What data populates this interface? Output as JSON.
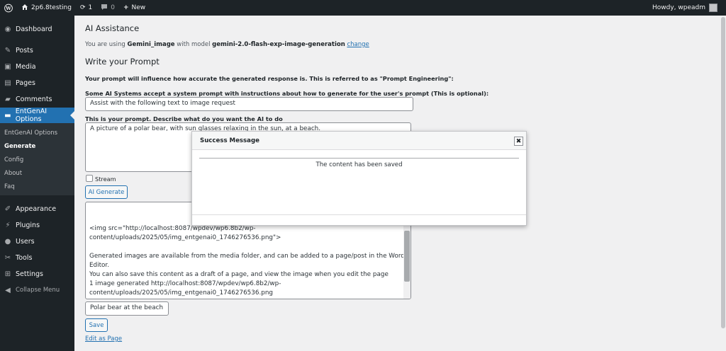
{
  "adminbar": {
    "site_name": "2p6.8testing",
    "updates_count": "1",
    "comments_count": "0",
    "new_label": "New",
    "howdy": "Howdy, wpeadm"
  },
  "sidebar": {
    "items": [
      {
        "label": "Dashboard",
        "icon": "dashboard-icon"
      },
      {
        "label": "Posts",
        "icon": "pin-icon"
      },
      {
        "label": "Media",
        "icon": "media-icon"
      },
      {
        "label": "Pages",
        "icon": "pages-icon"
      },
      {
        "label": "Comments",
        "icon": "comments-icon"
      },
      {
        "label": "EntGenAI Options",
        "icon": "options-icon"
      },
      {
        "label": "Appearance",
        "icon": "brush-icon"
      },
      {
        "label": "Plugins",
        "icon": "plugin-icon"
      },
      {
        "label": "Users",
        "icon": "users-icon"
      },
      {
        "label": "Tools",
        "icon": "wrench-icon"
      },
      {
        "label": "Settings",
        "icon": "settings-icon"
      }
    ],
    "submenu": [
      "EntGenAI Options",
      "Generate",
      "Config",
      "About",
      "Faq"
    ],
    "collapse_label": "Collapse Menu"
  },
  "main": {
    "title": "AI Assistance",
    "using_prefix": "You are using ",
    "using_engine": "Gemini_image",
    "using_mid": " with model ",
    "using_model": "gemini-2.0-flash-exp-image-generation",
    "change_link": "change",
    "prompt_heading": "Write your Prompt",
    "intro": "Your prompt will influence how accurate the generated response is. This is referred to as \"Prompt Engineering\":",
    "system_label": "Some AI Systems accept a system prompt with instructions about how to generate for the user's prompt (This is optional):",
    "system_value": "Assist with the following text to image request",
    "prompt_label": "This is your prompt. Describe what do you want the AI to do",
    "prompt_value": "A picture of a polar bear, with sun glasses relaxing in the sun, at a beach.",
    "stream_label": "Stream",
    "generate_label": "AI Generate",
    "output_lines": [
      "<img src=\"http://localhost:8087/wpdev/wp6.8b2/wp-",
      "content/uploads/2025/05/img_entgenai0_1746276536.png\">",
      "Generated images are available from the media folder, and can be added to a page/post in the Wordpress",
      "Editor.",
      "You can also save this content as a draft of a page, and view the image when you edit the page",
      "1 image generated http://localhost:8087/wpdev/wp6.8b2/wp-",
      "content/uploads/2025/05/img_entgenai0_1746276536.png"
    ],
    "title_value": "Polar bear at the beach",
    "save_label": "Save",
    "edit_link": "Edit as Page"
  },
  "dialog": {
    "title": "Success Message",
    "message": "The content has been saved",
    "close_glyph": "✖"
  }
}
